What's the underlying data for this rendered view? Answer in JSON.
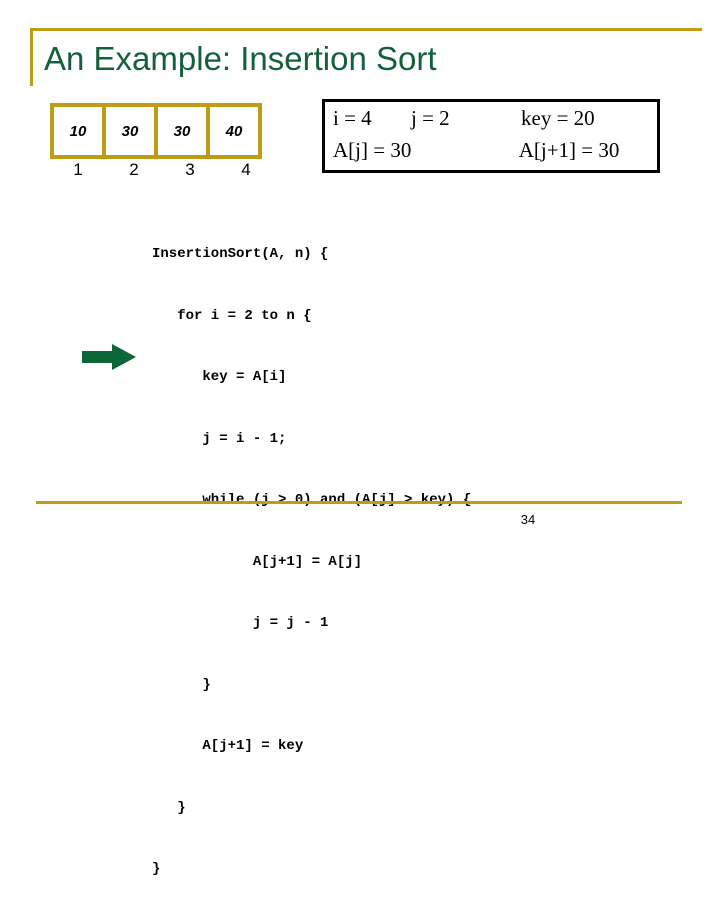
{
  "slide": {
    "title": "An Example: Insertion Sort",
    "page_number": "34",
    "accent_gold": "#bf9b16",
    "accent_green": "#14603a",
    "pointer_icon": "green-right-arrow-icon"
  },
  "array": {
    "values": [
      "10",
      "30",
      "30",
      "40"
    ],
    "indices": [
      "1",
      "2",
      "3",
      "4"
    ]
  },
  "variables": {
    "line1": {
      "i": "i = 4",
      "j": "j = 2",
      "key": "key = 20"
    },
    "line2": {
      "aj": "A[j] = 30",
      "ajp1": "A[j+1] = 30"
    }
  },
  "code": {
    "lines": [
      "InsertionSort(A, n) {",
      "   for i = 2 to n {",
      "      key = A[i]",
      "      j = i - 1;",
      "      while (j > 0) and (A[j] > key) {",
      "            A[j+1] = A[j]",
      "            j = j - 1",
      "      }",
      "      A[j+1] = key",
      "   }",
      "}"
    ]
  }
}
